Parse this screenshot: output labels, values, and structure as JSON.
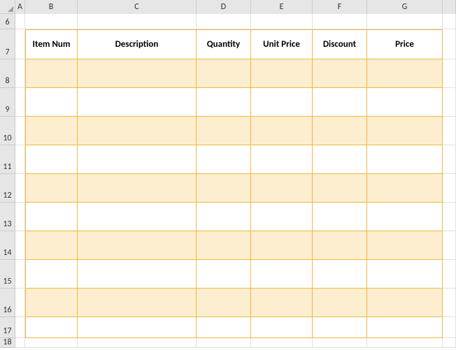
{
  "columns": [
    "A",
    "B",
    "C",
    "D",
    "E",
    "F",
    "G"
  ],
  "row_labels": [
    "6",
    "7",
    "8",
    "9",
    "10",
    "11",
    "12",
    "13",
    "14",
    "15",
    "16",
    "17",
    "18"
  ],
  "table": {
    "headers": [
      "Item Num",
      "Description",
      "Quantity",
      "Unit Price",
      "Discount",
      "Price"
    ],
    "rows": [
      {
        "item_num": "",
        "description": "",
        "quantity": "",
        "unit_price": "",
        "discount": "",
        "price": ""
      },
      {
        "item_num": "",
        "description": "",
        "quantity": "",
        "unit_price": "",
        "discount": "",
        "price": ""
      },
      {
        "item_num": "",
        "description": "",
        "quantity": "",
        "unit_price": "",
        "discount": "",
        "price": ""
      },
      {
        "item_num": "",
        "description": "",
        "quantity": "",
        "unit_price": "",
        "discount": "",
        "price": ""
      },
      {
        "item_num": "",
        "description": "",
        "quantity": "",
        "unit_price": "",
        "discount": "",
        "price": ""
      },
      {
        "item_num": "",
        "description": "",
        "quantity": "",
        "unit_price": "",
        "discount": "",
        "price": ""
      },
      {
        "item_num": "",
        "description": "",
        "quantity": "",
        "unit_price": "",
        "discount": "",
        "price": ""
      },
      {
        "item_num": "",
        "description": "",
        "quantity": "",
        "unit_price": "",
        "discount": "",
        "price": ""
      },
      {
        "item_num": "",
        "description": "",
        "quantity": "",
        "unit_price": "",
        "discount": "",
        "price": ""
      },
      {
        "item_num": "",
        "description": "",
        "quantity": "",
        "unit_price": "",
        "discount": "",
        "price": ""
      }
    ],
    "shaded_rows": [
      0,
      2,
      4,
      6,
      8
    ],
    "colors": {
      "border": "#f0b840",
      "shade": "#fdeecf"
    }
  }
}
